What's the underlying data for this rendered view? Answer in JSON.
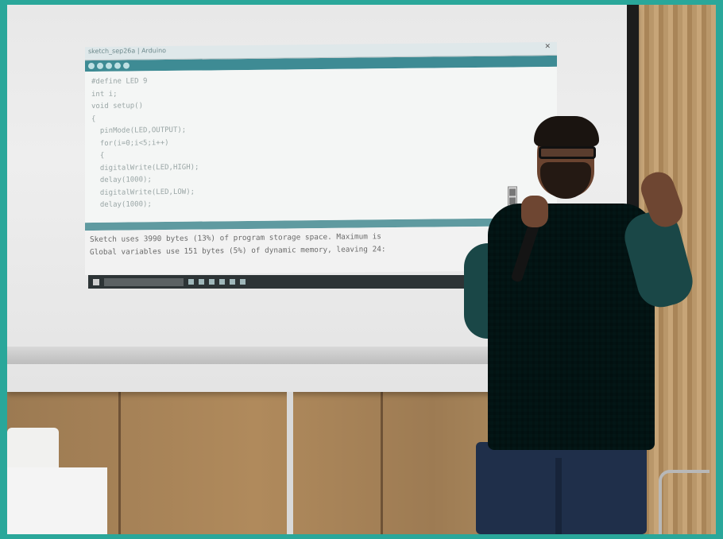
{
  "colors": {
    "frame": "#2aa79a",
    "screen": "#ececec",
    "toolbar": "#3e8b94",
    "shirt": "#1d4b4a",
    "wall": "#a98556"
  },
  "projection": {
    "window_title": "sketch_sep26a | Arduino",
    "code_lines": [
      "#define LED 9",
      "int i;",
      "void setup()",
      "{",
      "  pinMode(LED,OUTPUT);",
      "  for(i=0;i<5;i++)",
      "  {",
      "  digitalWrite(LED,HIGH);",
      "  delay(1000);",
      "  digitalWrite(LED,LOW);",
      "  delay(1000);"
    ],
    "console_lines": [
      "Sketch uses 3990 bytes (13%) of program storage space. Maximum is",
      "Global variables use 151 bytes (5%) of dynamic memory, leaving 24:"
    ]
  }
}
